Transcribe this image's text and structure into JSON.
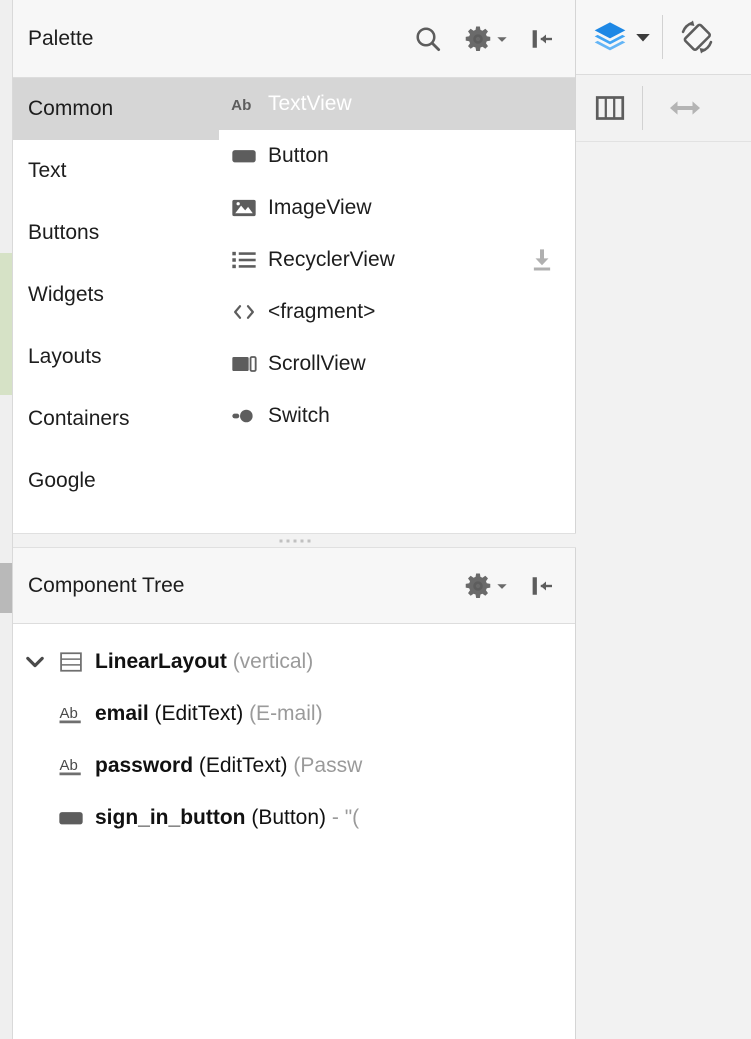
{
  "palette": {
    "title": "Palette",
    "header_actions": [
      {
        "name": "search-icon",
        "label": "Search"
      },
      {
        "name": "gear-icon",
        "label": "Palette Settings"
      },
      {
        "name": "hide-panel-icon",
        "label": "Hide"
      }
    ],
    "categories": [
      {
        "label": "Common",
        "selected": true
      },
      {
        "label": "Text",
        "selected": false
      },
      {
        "label": "Buttons",
        "selected": false
      },
      {
        "label": "Widgets",
        "selected": false
      },
      {
        "label": "Layouts",
        "selected": false
      },
      {
        "label": "Containers",
        "selected": false
      },
      {
        "label": "Google",
        "selected": false
      }
    ],
    "widgets": [
      {
        "label": "TextView",
        "icon": "textview-icon",
        "selected": true,
        "download": false
      },
      {
        "label": "Button",
        "icon": "button-icon",
        "selected": false,
        "download": false
      },
      {
        "label": "ImageView",
        "icon": "imageview-icon",
        "selected": false,
        "download": false
      },
      {
        "label": "RecyclerView",
        "icon": "recyclerview-icon",
        "selected": false,
        "download": true
      },
      {
        "label": "<fragment>",
        "icon": "fragment-icon",
        "selected": false,
        "download": false
      },
      {
        "label": "ScrollView",
        "icon": "scrollview-icon",
        "selected": false,
        "download": false
      },
      {
        "label": "Switch",
        "icon": "switch-icon",
        "selected": false,
        "download": false
      }
    ]
  },
  "component_tree": {
    "title": "Component Tree",
    "header_actions": [
      {
        "name": "gear-icon",
        "label": "Tree Settings"
      },
      {
        "name": "hide-panel-icon",
        "label": "Hide"
      }
    ],
    "rows": [
      {
        "icon": "linearlayout-icon",
        "id": "LinearLayout",
        "type": " (vertical)",
        "hint": "",
        "expanded": true
      },
      {
        "icon": "edittext-icon",
        "id": "email",
        "type": " (EditText)",
        "hint": " (E-mail)"
      },
      {
        "icon": "edittext-icon",
        "id": "password",
        "type": " (EditText)",
        "hint": " (Passw"
      },
      {
        "icon": "button-icon",
        "id": "sign_in_button",
        "type": " (Button)",
        "hint": " - \"("
      }
    ]
  },
  "design_toolbar": {
    "top_actions": [
      {
        "name": "design-mode-layers-icon",
        "label": "Design Surface Mode"
      },
      {
        "name": "chevron-down-icon",
        "label": "Mode Options"
      },
      {
        "name": "rotate-orientation-icon",
        "label": "Orientation for Preview"
      }
    ],
    "second_actions": [
      {
        "name": "columns-view-icon",
        "label": "Split Editor"
      },
      {
        "name": "horizontal-resize-icon",
        "label": "Resize"
      }
    ]
  },
  "colors": {
    "accent_blue": "#2196f3",
    "selection_grey": "#d6d6d6",
    "panel_header": "#f7f7f7",
    "gutter_green": "#d6e2c6",
    "icon_grey": "#5d5d5d",
    "hint_grey": "#9a9a9a"
  }
}
